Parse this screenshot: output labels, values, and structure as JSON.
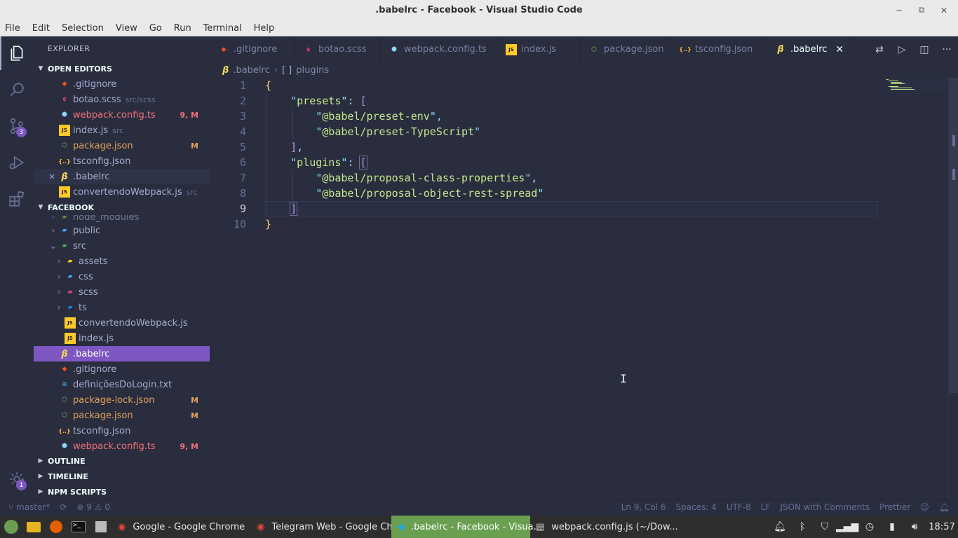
{
  "window": {
    "title": ".babelrc - Facebook - Visual Studio Code"
  },
  "menu": [
    "File",
    "Edit",
    "Selection",
    "View",
    "Go",
    "Run",
    "Terminal",
    "Help"
  ],
  "activity": {
    "scm_badge": "3",
    "settings_badge": "1"
  },
  "sidebar": {
    "title": "EXPLORER",
    "open_editors_title": "OPEN EDITORS",
    "open_editors": [
      {
        "name": ".gitignore",
        "desc": "",
        "badge": "",
        "icon": "git"
      },
      {
        "name": "botao.scss",
        "desc": "src/scss",
        "badge": "",
        "icon": "scss"
      },
      {
        "name": "webpack.config.ts",
        "desc": "",
        "badge": "9, M",
        "icon": "webpack",
        "state": "err"
      },
      {
        "name": "index.js",
        "desc": "src",
        "badge": "",
        "icon": "js"
      },
      {
        "name": "package.json",
        "desc": "",
        "badge": "M",
        "icon": "node",
        "state": "mod"
      },
      {
        "name": "tsconfig.json",
        "desc": "",
        "badge": "",
        "icon": "json"
      },
      {
        "name": ".babelrc",
        "desc": "",
        "badge": "",
        "icon": "babel",
        "close": "✕"
      },
      {
        "name": "convertendoWebpack.js",
        "desc": "src",
        "badge": "",
        "icon": "js"
      }
    ],
    "project_title": "FACEBOOK",
    "tree": [
      {
        "name": "node_modules",
        "indent": 1,
        "chev": "›",
        "icon": "folder-node",
        "partial": true
      },
      {
        "name": "public",
        "indent": 1,
        "chev": "›",
        "icon": "folder-public"
      },
      {
        "name": "src",
        "indent": 1,
        "chev": "⌄",
        "icon": "folder-src"
      },
      {
        "name": "assets",
        "indent": 2,
        "chev": "›",
        "icon": "folder-yellow"
      },
      {
        "name": "css",
        "indent": 2,
        "chev": "›",
        "icon": "folder-css"
      },
      {
        "name": "scss",
        "indent": 2,
        "chev": "›",
        "icon": "folder-scss"
      },
      {
        "name": "ts",
        "indent": 2,
        "chev": "›",
        "icon": "folder-ts"
      },
      {
        "name": "convertendoWebpack.js",
        "indent": 2,
        "chev": "",
        "icon": "js"
      },
      {
        "name": "index.js",
        "indent": 2,
        "chev": "",
        "icon": "js"
      },
      {
        "name": ".babelrc",
        "indent": 1,
        "chev": "",
        "icon": "babel",
        "selected": true
      },
      {
        "name": ".gitignore",
        "indent": 1,
        "chev": "",
        "icon": "git"
      },
      {
        "name": "definiçõesDoLogin.txt",
        "indent": 1,
        "chev": "",
        "icon": "txt"
      },
      {
        "name": "package-lock.json",
        "indent": 1,
        "chev": "",
        "icon": "node",
        "badge": "M",
        "state": "mod"
      },
      {
        "name": "package.json",
        "indent": 1,
        "chev": "",
        "icon": "node",
        "badge": "M",
        "state": "mod"
      },
      {
        "name": "tsconfig.json",
        "indent": 1,
        "chev": "",
        "icon": "json"
      },
      {
        "name": "webpack.config.ts",
        "indent": 1,
        "chev": "",
        "icon": "webpack",
        "badge": "9, M",
        "state": "err"
      }
    ],
    "collapsed_sections": [
      "OUTLINE",
      "TIMELINE",
      "NPM SCRIPTS"
    ]
  },
  "tabs": [
    {
      "name": ".gitignore",
      "icon": "git"
    },
    {
      "name": "botao.scss",
      "icon": "scss"
    },
    {
      "name": "webpack.config.ts",
      "icon": "webpack"
    },
    {
      "name": "index.js",
      "icon": "js"
    },
    {
      "name": "package.json",
      "icon": "node"
    },
    {
      "name": "tsconfig.json",
      "icon": "json"
    },
    {
      "name": ".babelrc",
      "icon": "babel",
      "active": true
    }
  ],
  "breadcrumb": {
    "file": ".babelrc",
    "symbol_icon": "[ ]",
    "symbol": "plugins"
  },
  "code": {
    "lines": [
      "1",
      "2",
      "3",
      "4",
      "5",
      "6",
      "7",
      "8",
      "9",
      "10"
    ],
    "open_brace": "{",
    "close_brace": "}",
    "presets_key": "presets",
    "plugins_key": "plugins",
    "preset_env": "@babel/preset-env",
    "preset_ts": "@babel/preset-TypeScript",
    "plugin_class": "@babel/proposal-class-properties",
    "plugin_rest": "@babel/proposal-object-rest-spread"
  },
  "status": {
    "branch": "master*",
    "errors": "9",
    "warnings": "0",
    "position": "Ln 9, Col 6",
    "spaces": "Spaces: 4",
    "encoding": "UTF-8",
    "eol": "LF",
    "language": "JSON with Comments",
    "formatter": "Prettier"
  },
  "taskbar": {
    "apps": [
      {
        "name": "Google - Google Chrome",
        "icon": "chrome"
      },
      {
        "name": "Telegram Web - Google Ch...",
        "icon": "chrome"
      },
      {
        "name": ".babelrc - Facebook - Visua...",
        "icon": "vscode",
        "active": true
      },
      {
        "name": "webpack.config.js (~/Dow...",
        "icon": "editor"
      }
    ],
    "time": "18:57"
  },
  "colors": {
    "accent": "#7e57c2",
    "bg": "#292d3e",
    "string": "#c3e88d",
    "modified": "#e2a25b",
    "error": "#f07178"
  }
}
